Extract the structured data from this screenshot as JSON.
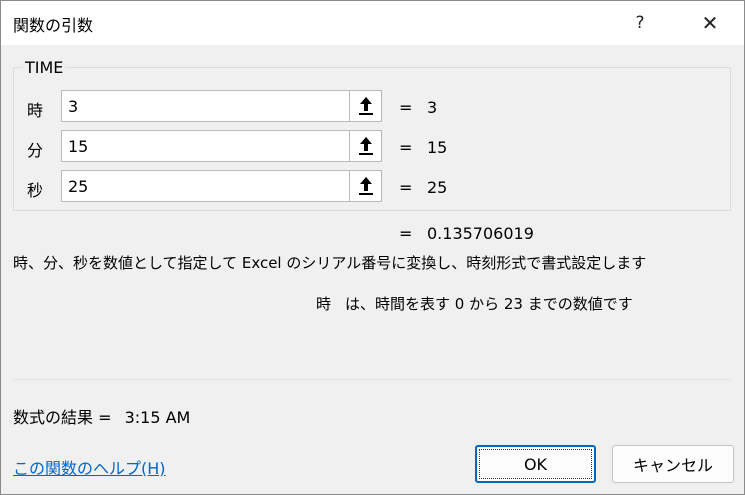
{
  "window": {
    "title": "関数の引数",
    "help_label": "?",
    "close_label": "✕"
  },
  "function": {
    "name": "TIME",
    "args": [
      {
        "label": "時",
        "value": "3",
        "result": "3"
      },
      {
        "label": "分",
        "value": "15",
        "result": "15"
      },
      {
        "label": "秒",
        "value": "25",
        "result": "25"
      }
    ],
    "equals_sign": "=",
    "total_result": "0.135706019",
    "description": "時、分、秒を数値として指定して Excel のシリアル番号に変換し、時刻形式で書式設定します",
    "arg_help_name": "時",
    "arg_help_text": "は、時間を表す 0 から 23 までの数値です"
  },
  "footer": {
    "result_label": "数式の結果 =",
    "result_value": "3:15 AM",
    "help_link": "この関数のヘルプ(H)",
    "ok_label": "OK",
    "cancel_label": "キャンセル"
  },
  "icons": {
    "ref_button": "arrow-up-underline-icon"
  }
}
